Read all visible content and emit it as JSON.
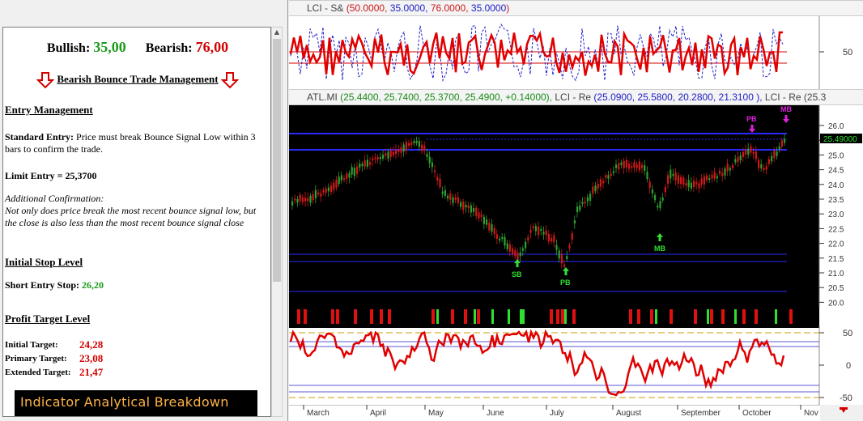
{
  "sentiment": {
    "bullish_label": "Bullish:",
    "bullish_value": "35,00",
    "bearish_label": "Bearish:",
    "bearish_value": "76,00"
  },
  "trade": {
    "title": "Bearish Bounce Trade Management",
    "entry_heading": "Entry Management",
    "standard_entry_label": "Standard Entry:",
    "standard_entry_text": "Price must break Bounce Signal Low within 3 bars to confirm the trade.",
    "limit_entry": "Limit Entry = 25,3700",
    "additional_label": "Additional Confirmation:",
    "additional_text": "Not only does price break the most recent bounce signal low, but the close is also less than the most recent bounce signal close",
    "stop_heading": "Initial Stop Level",
    "stop_label": "Short Entry Stop:",
    "stop_value": "26,20",
    "profit_heading": "Profit Target Level",
    "targets": [
      {
        "label": "Initial Target:",
        "value": "24,28"
      },
      {
        "label": "Primary Target:",
        "value": "23,08"
      },
      {
        "label": "Extended Target:",
        "value": "21,47"
      }
    ],
    "banner": "Indicator Analytical Breakdown"
  },
  "top_panel": {
    "title": "LCI - S&",
    "params_open": "(",
    "p1": "50.0000,",
    "p2": "35.0000,",
    "p3": "76.0000,",
    "p4": "35.0000",
    "params_close": ")",
    "axis_label": "50"
  },
  "price_panel": {
    "symbol": "ATL.MI",
    "ohlc": "(25.4400, 25.7400, 25.3700, 25.4900, +0.14000),",
    "lci_label": "LCI - Re",
    "lci_values": "(25.0900, 25.5800, 20.2800, 21.3100 ),",
    "lci_label2": "LCI - Re (25.3",
    "last_price": "25.49000",
    "y_ticks": [
      "26.0",
      "25.5",
      "25.0",
      "24.5",
      "24.0",
      "23.5",
      "23.0",
      "22.5",
      "22.0",
      "21.5",
      "21.0",
      "20.5",
      "20.0"
    ],
    "signals": [
      {
        "text": "SB"
      },
      {
        "text": "PB"
      },
      {
        "text": "MB"
      },
      {
        "text": "PB"
      },
      {
        "text": "MB"
      }
    ]
  },
  "osc_panel": {
    "y_ticks": [
      "50",
      "0",
      "-50"
    ]
  },
  "months": [
    "March",
    "April",
    "May",
    "June",
    "July",
    "August",
    "September",
    "October",
    "Nov"
  ],
  "colors": {
    "bull": "#1a9a1a",
    "bear": "#d40000",
    "line_blue": "#2020c8",
    "banner_text": "#ffb347"
  }
}
